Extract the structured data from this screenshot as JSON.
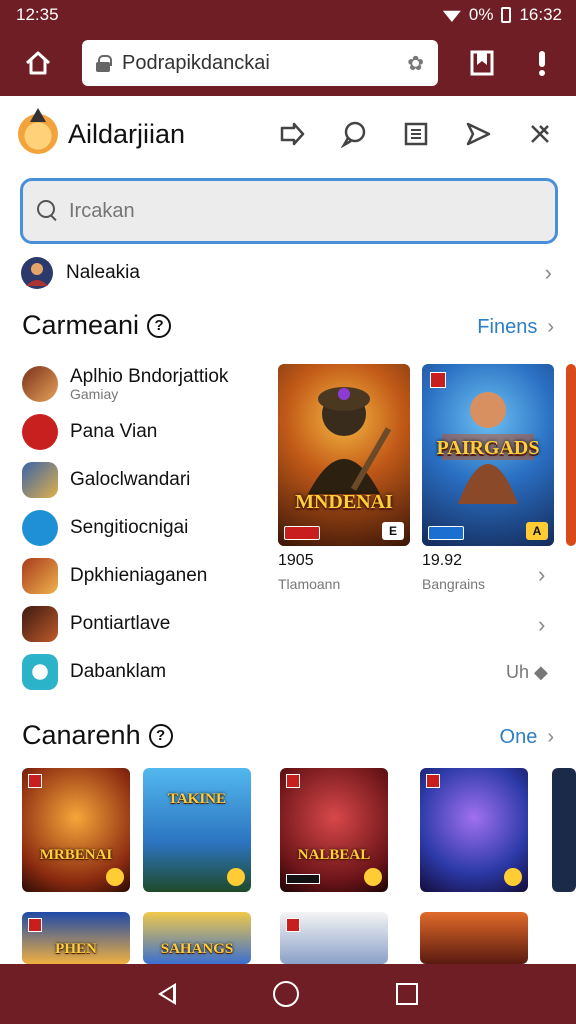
{
  "status": {
    "time_left": "12:35",
    "signal": "0%",
    "time_right": "16:32"
  },
  "browser": {
    "url": "Podrapikdanckai",
    "home_icon": "home-icon",
    "bookmark_icon": "bookmark-icon",
    "menu_icon": "exclamation-icon"
  },
  "app": {
    "title": "Aildarjiian",
    "header_icons": [
      "share-icon",
      "chat-icon",
      "document-icon",
      "send-icon",
      "close-icon"
    ]
  },
  "search": {
    "placeholder": "Ircakan"
  },
  "top_link": {
    "label": "Naleakia"
  },
  "section1": {
    "title": "Carmeani",
    "see_more": "Finens",
    "apps": [
      {
        "name": "Aplhio Bndorjattiok",
        "sub": "Gamiay",
        "color": "#7a2f1a"
      },
      {
        "name": "Pana Vian",
        "color": "#c8201f"
      },
      {
        "name": "Galoclwandari",
        "color": "#3a63a8"
      },
      {
        "name": "Sengitiocnigai",
        "color": "#1f8fd6"
      },
      {
        "name": "Dpkhieniaganen",
        "color": "#a63a1d"
      },
      {
        "name": "Pontiartlave",
        "color": "#8a2a18"
      },
      {
        "name": "Dabanklam",
        "color": "#2bb3c9"
      }
    ],
    "right_meta": "Uh",
    "featured": [
      {
        "title": "MNDENAI",
        "corner": "E",
        "rating": "1905",
        "sub": "Tlamoann"
      },
      {
        "title": "PAIRGADS",
        "corner": "A",
        "rating": "19.92",
        "sub": "Bangrains"
      }
    ]
  },
  "section2": {
    "title": "Canarenh",
    "see_more": "One",
    "tiles": [
      {
        "title": "MRBENAI"
      },
      {
        "title": "TAKINE"
      },
      {
        "title": "NALBEAL"
      },
      {
        "title": ""
      },
      {
        "title": "PHEN"
      },
      {
        "title": "SAHANGS"
      },
      {
        "title": ""
      },
      {
        "title": ""
      }
    ]
  },
  "colors": {
    "brand": "#6e1e24",
    "accent": "#2f7ec4",
    "search_border": "#4a90d9"
  }
}
